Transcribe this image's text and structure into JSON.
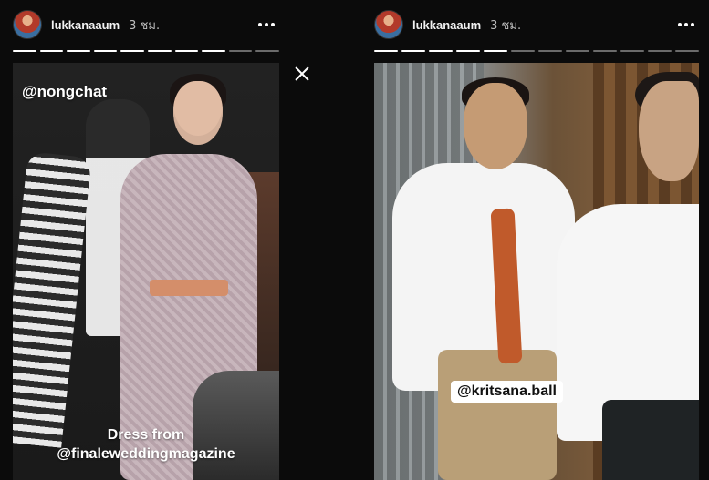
{
  "stories": [
    {
      "username": "lukkanaaum",
      "time": "3 ชม.",
      "progress": {
        "segments": 10,
        "completed": 8
      },
      "mentions": [
        "@nongchat"
      ],
      "caption": {
        "line1": "Dress from",
        "line2": "@finaleweddingmagazine"
      }
    },
    {
      "username": "lukkanaaum",
      "time": "3 ชม.",
      "progress": {
        "segments": 12,
        "completed": 5
      },
      "mentions": [
        "@kritsana.ball"
      ]
    }
  ],
  "icons": {
    "more": "more-horizontal-icon",
    "close": "close-icon"
  },
  "colors": {
    "background": "#0b0b0b",
    "progress_done": "#ffffff",
    "progress_pending": "#6b6b6b"
  }
}
